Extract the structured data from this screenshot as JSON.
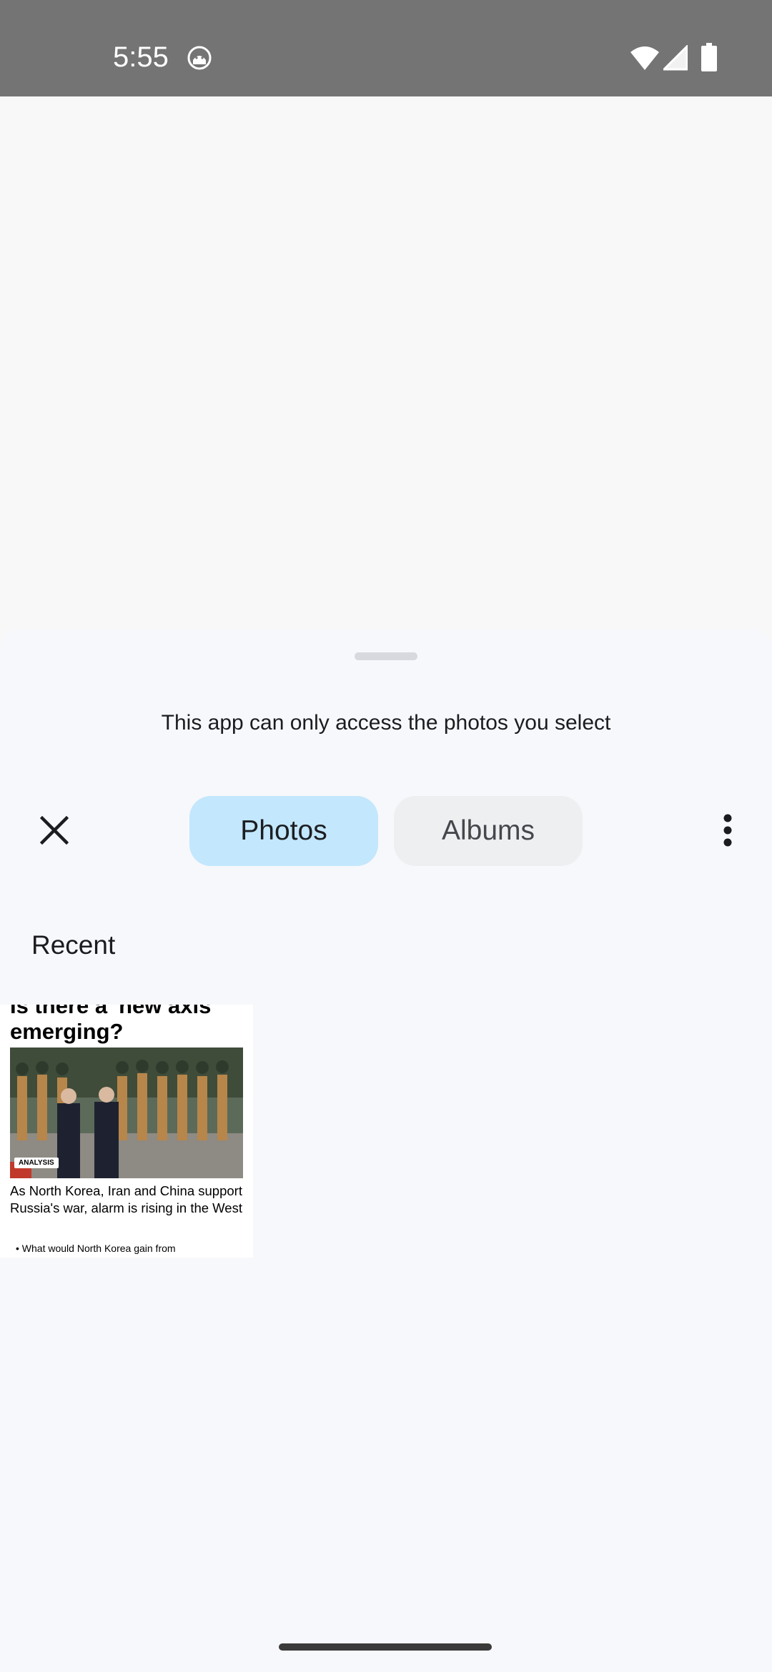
{
  "status_bar": {
    "time": "5:55",
    "app_icon": "android-debug-icon",
    "wifi_icon": "wifi-icon",
    "signal_icon": "cell-signal-icon",
    "battery_icon": "battery-icon"
  },
  "picker": {
    "message": "This app can only access the photos you select",
    "close_icon": "close-icon",
    "overflow_icon": "more-vert-icon",
    "tabs": [
      {
        "label": "Photos",
        "selected": true
      },
      {
        "label": "Albums",
        "selected": false
      }
    ],
    "section_title": "Recent",
    "media": [
      {
        "headline": "Is there a 'new axis' emerging?",
        "badge": "ANALYSIS",
        "summary": "As North Korea, Iran and China support Russia's war, alarm is rising in the West",
        "bullet": "What would North Korea gain from"
      }
    ]
  },
  "colors": {
    "status_bar_bg": "#747474",
    "sheet_bg": "#f7f8fb",
    "tab_selected_bg": "#c3e7fd",
    "tab_unselected_bg": "#eeeff1"
  }
}
